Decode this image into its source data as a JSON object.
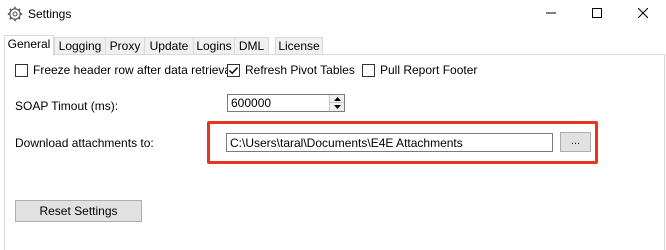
{
  "window": {
    "title": "Settings",
    "app_icon": "gear-icon",
    "controls": [
      "minimize-icon",
      "maximize-icon",
      "close-icon"
    ]
  },
  "tabs": [
    {
      "label": "General",
      "active": true
    },
    {
      "label": "Logging",
      "active": false
    },
    {
      "label": "Proxy",
      "active": false
    },
    {
      "label": "Update",
      "active": false
    },
    {
      "label": "Logins",
      "active": false
    },
    {
      "label": "DML",
      "active": false
    },
    {
      "label": "License",
      "active": false
    }
  ],
  "options": {
    "freeze_header": {
      "label": "Freeze header row after data retrieval",
      "checked": false
    },
    "refresh_pivot": {
      "label": "Refresh Pivot Tables",
      "checked": true
    },
    "pull_footer": {
      "label": "Pull Report Footer",
      "checked": false
    }
  },
  "soap_timeout": {
    "label": "SOAP Timout (ms):",
    "value": "600000"
  },
  "download": {
    "label": "Download attachments to:",
    "path": "C:\\Users\\taral\\Documents\\E4E Attachments",
    "browse_label": "..."
  },
  "reset_label": "Reset Settings",
  "colors": {
    "highlight": "#e8341c",
    "button_face": "#e1e1e1",
    "tab_inactive": "#f0f0f0"
  }
}
